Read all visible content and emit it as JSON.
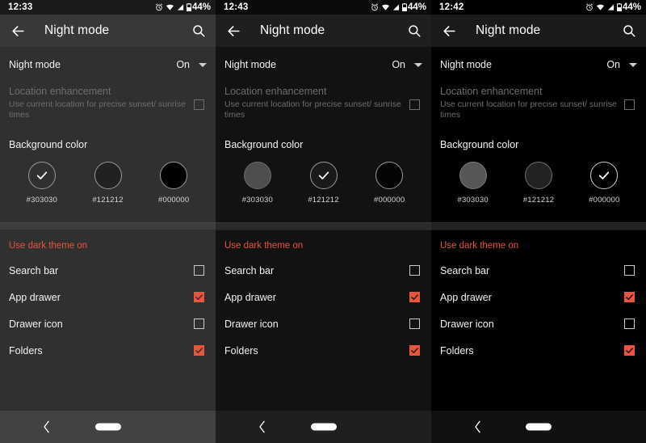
{
  "screens": [
    {
      "id": "screen-1",
      "theme_name": "#303030",
      "background": "#303030",
      "statusbar": {
        "time": "12:33",
        "battery": "44%",
        "icons": [
          "alarm-icon",
          "wifi-icon",
          "signal-icon",
          "battery-icon"
        ]
      },
      "appbar": {
        "back_label": "back-arrow",
        "title": "Night mode",
        "search_label": "search"
      },
      "night_mode": {
        "label": "Night mode",
        "value": "On"
      },
      "location": {
        "title": "Location enhancement",
        "subtitle": "Use current location for precise sunset/ sunrise times",
        "checked": false
      },
      "background_color": {
        "title": "Background color",
        "options": [
          {
            "label": "#303030",
            "color": "#303030",
            "selected": true
          },
          {
            "label": "#121212",
            "color": "#121212",
            "selected": false
          },
          {
            "label": "#000000",
            "color": "#000000",
            "selected": false
          }
        ]
      },
      "dark_theme": {
        "title": "Use dark theme on",
        "accent": "#e8543c",
        "items": [
          {
            "label": "Search bar",
            "checked": false
          },
          {
            "label": "App drawer",
            "checked": true
          },
          {
            "label": "Drawer icon",
            "checked": false
          },
          {
            "label": "Folders",
            "checked": true
          }
        ]
      },
      "navbar": {
        "back": "nav-back",
        "home": "home-pill"
      }
    },
    {
      "id": "screen-2",
      "theme_name": "#121212",
      "background": "#121212",
      "statusbar": {
        "time": "12:43",
        "battery": "44%",
        "icons": [
          "alarm-icon",
          "wifi-icon",
          "signal-icon",
          "battery-icon"
        ]
      },
      "appbar": {
        "back_label": "back-arrow",
        "title": "Night mode",
        "search_label": "search"
      },
      "night_mode": {
        "label": "Night mode",
        "value": "On"
      },
      "location": {
        "title": "Location enhancement",
        "subtitle": "Use current location for precise sunset/ sunrise times",
        "checked": false
      },
      "background_color": {
        "title": "Background color",
        "options": [
          {
            "label": "#303030",
            "color": "#4e4e4e",
            "selected": false
          },
          {
            "label": "#121212",
            "color": "#121212",
            "selected": true
          },
          {
            "label": "#000000",
            "color": "#000000",
            "selected": false
          }
        ]
      },
      "dark_theme": {
        "title": "Use dark theme on",
        "accent": "#e8543c",
        "items": [
          {
            "label": "Search bar",
            "checked": false
          },
          {
            "label": "App drawer",
            "checked": true
          },
          {
            "label": "Drawer icon",
            "checked": false
          },
          {
            "label": "Folders",
            "checked": true
          }
        ]
      },
      "navbar": {
        "back": "nav-back",
        "home": "home-pill"
      }
    },
    {
      "id": "screen-3",
      "theme_name": "#000000",
      "background": "#000000",
      "statusbar": {
        "time": "12:42",
        "battery": "44%",
        "icons": [
          "alarm-icon",
          "wifi-icon",
          "signal-icon",
          "battery-icon"
        ]
      },
      "appbar": {
        "back_label": "back-arrow",
        "title": "Night mode",
        "search_label": "search"
      },
      "night_mode": {
        "label": "Night mode",
        "value": "On"
      },
      "location": {
        "title": "Location enhancement",
        "subtitle": "Use current location for precise sunset/ sunrise times",
        "checked": false
      },
      "background_color": {
        "title": "Background color",
        "options": [
          {
            "label": "#303030",
            "color": "#565656",
            "selected": false
          },
          {
            "label": "#121212",
            "color": "#222222",
            "selected": false
          },
          {
            "label": "#000000",
            "color": "#000000",
            "selected": true
          }
        ]
      },
      "dark_theme": {
        "title": "Use dark theme on",
        "accent": "#e8543c",
        "items": [
          {
            "label": "Search bar",
            "checked": false
          },
          {
            "label": "App drawer",
            "checked": true
          },
          {
            "label": "Drawer icon",
            "checked": false
          },
          {
            "label": "Folders",
            "checked": true
          }
        ]
      },
      "navbar": {
        "back": "nav-back",
        "home": "home-pill"
      }
    }
  ]
}
